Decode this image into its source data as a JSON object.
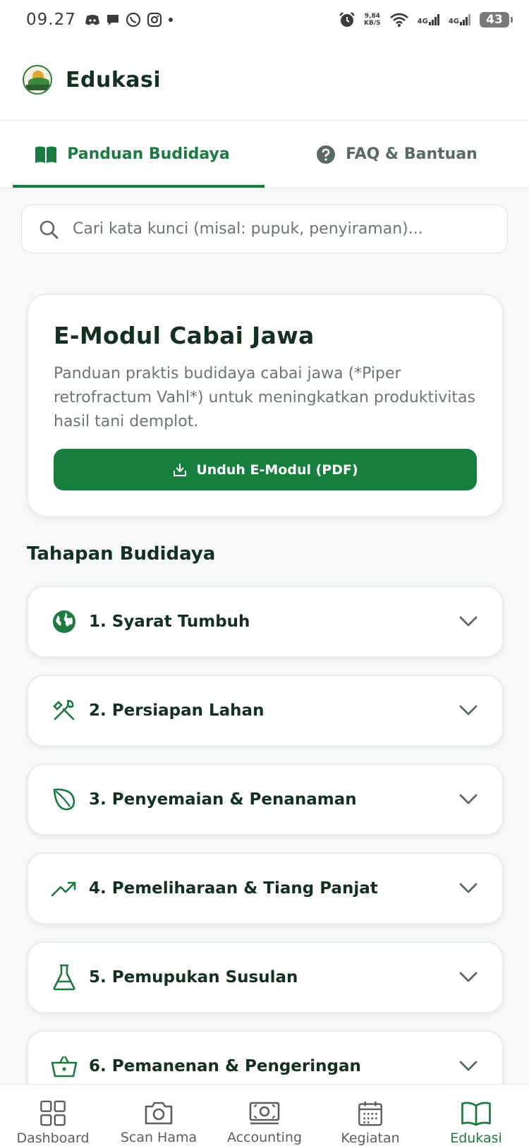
{
  "status_bar": {
    "time": "09.27",
    "speed_value": "9,84",
    "speed_unit": "KB/S",
    "net1": "4G",
    "net2": "4G",
    "battery": "43"
  },
  "app_bar": {
    "title": "Edukasi"
  },
  "tabs": [
    {
      "label": "Panduan Budidaya",
      "icon": "book-icon",
      "active": true
    },
    {
      "label": "FAQ & Bantuan",
      "icon": "question-icon",
      "active": false
    }
  ],
  "search": {
    "placeholder": "Cari kata kunci (misal: pupuk, penyiraman)..."
  },
  "module_card": {
    "title": "E-Modul Cabai Jawa",
    "description": "Panduan praktis budidaya cabai jawa (*Piper retrofractum Vahl*) untuk meningkatkan produktivitas hasil tani demplot.",
    "button_label": "Unduh E-Modul (PDF)"
  },
  "stages": {
    "title": "Tahapan Budidaya",
    "items": [
      {
        "label": "1. Syarat Tumbuh",
        "icon": "globe-icon"
      },
      {
        "label": "2. Persiapan Lahan",
        "icon": "tools-icon"
      },
      {
        "label": "3. Penyemaian & Penanaman",
        "icon": "leaf-icon"
      },
      {
        "label": "4. Pemeliharaan & Tiang Panjat",
        "icon": "trending-up-icon"
      },
      {
        "label": "5. Pemupukan Susulan",
        "icon": "flask-icon"
      },
      {
        "label": "6. Pemanenan & Pengeringan",
        "icon": "basket-icon"
      }
    ]
  },
  "bottom_nav": [
    {
      "label": "Dashboard",
      "icon": "grid-icon",
      "active": false
    },
    {
      "label": "Scan Hama",
      "icon": "camera-icon",
      "active": false
    },
    {
      "label": "Accounting",
      "icon": "money-icon",
      "active": false
    },
    {
      "label": "Kegiatan",
      "icon": "calendar-icon",
      "active": false
    },
    {
      "label": "Edukasi",
      "icon": "book-icon",
      "active": true
    }
  ],
  "colors": {
    "primary": "#177e3d",
    "text_dark": "#14301f",
    "text_muted": "#6b7670",
    "background": "#f7f9f8"
  }
}
